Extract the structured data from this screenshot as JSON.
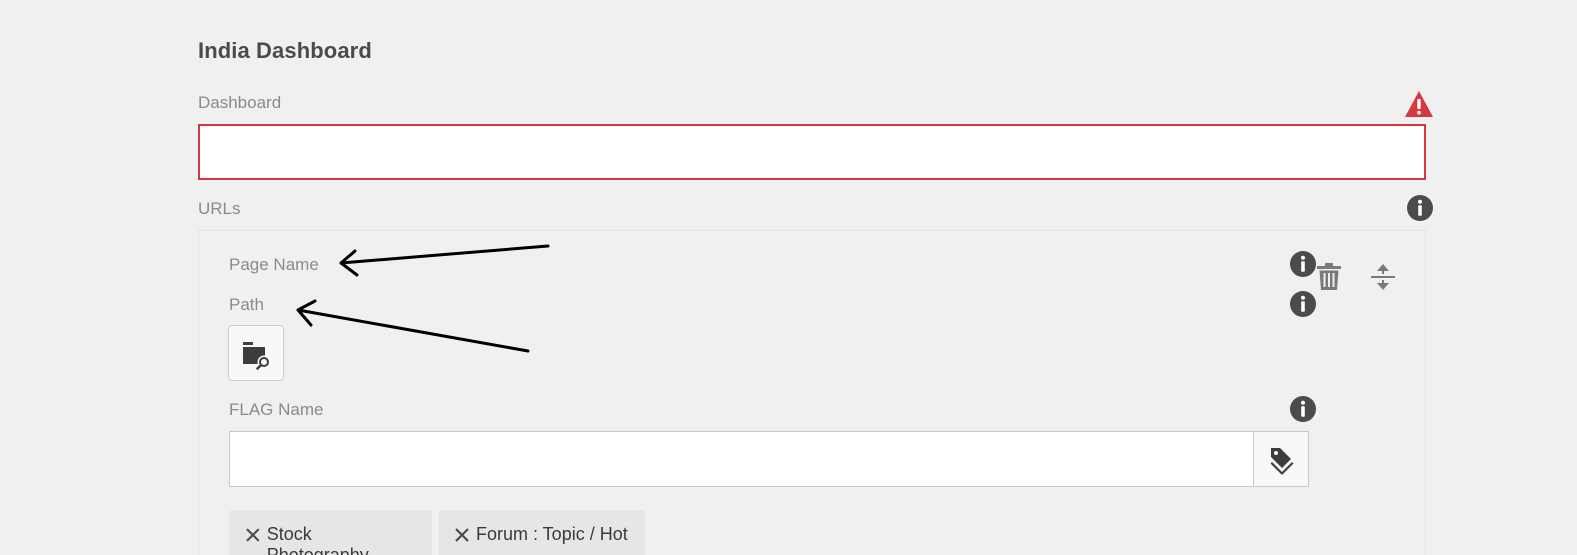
{
  "page": {
    "title": "India Dashboard"
  },
  "dashboard": {
    "label": "Dashboard",
    "value": "",
    "status": "error"
  },
  "urls": {
    "label": "URLs",
    "item": {
      "page_name_label": "Page Name",
      "path_label": "Path",
      "flag_label": "FLAG Name",
      "flag_value": "",
      "tags": [
        {
          "label": "Stock Photography"
        },
        {
          "label": "Forum : Topic / Hot"
        }
      ]
    }
  },
  "icons": {
    "warning": "alert-triangle-icon",
    "info": "info-icon",
    "delete": "trash-icon",
    "reorder": "reorder-icon",
    "path_browser": "folder-search-icon",
    "tag_picker": "tags-icon",
    "remove_tag": "close-icon"
  },
  "colors": {
    "background": "#f0f0f0",
    "error": "#d7373f",
    "text": "#4b4b4b",
    "label": "#8a8a8a",
    "icon": "#4b4b4b"
  }
}
